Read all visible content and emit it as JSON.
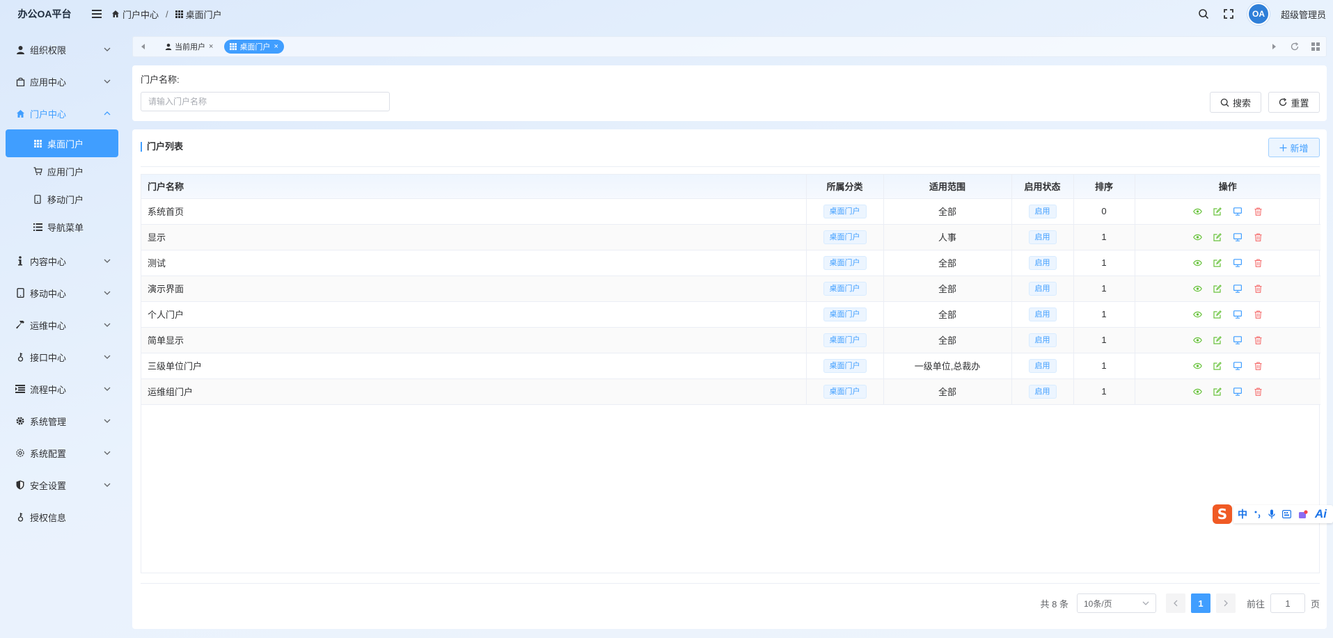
{
  "app": {
    "title": "办公OA平台"
  },
  "breadcrumb": [
    "门户中心",
    "桌面门户"
  ],
  "header": {
    "username": "超级管理员",
    "avatar_text": "OA"
  },
  "sidebar": {
    "items": [
      {
        "label": "组织权限",
        "icon": "user-icon"
      },
      {
        "label": "应用中心",
        "icon": "bag-icon"
      },
      {
        "label": "门户中心",
        "icon": "home-icon",
        "open": true,
        "children": [
          {
            "label": "桌面门户",
            "icon": "grid-icon",
            "active": true
          },
          {
            "label": "应用门户",
            "icon": "cart-icon"
          },
          {
            "label": "移动门户",
            "icon": "phone-icon"
          },
          {
            "label": "导航菜单",
            "icon": "list-icon"
          }
        ]
      },
      {
        "label": "内容中心",
        "icon": "info-icon"
      },
      {
        "label": "移动中心",
        "icon": "tablet-icon"
      },
      {
        "label": "运维中心",
        "icon": "hammer-icon"
      },
      {
        "label": "接口中心",
        "icon": "key-icon"
      },
      {
        "label": "流程中心",
        "icon": "process-icon"
      },
      {
        "label": "系统管理",
        "icon": "gear-icon"
      },
      {
        "label": "系统配置",
        "icon": "settings-icon"
      },
      {
        "label": "安全设置",
        "icon": "shield-icon"
      },
      {
        "label": "授权信息",
        "icon": "key-icon"
      }
    ]
  },
  "tabs": [
    {
      "label": "当前用户",
      "close": "×",
      "active": false
    },
    {
      "label": "桌面门户",
      "close": "×",
      "active": true
    }
  ],
  "search": {
    "label": "门户名称:",
    "placeholder": "请输入门户名称",
    "search_button": "搜索",
    "reset_button": "重置"
  },
  "list": {
    "title": "门户列表",
    "add_button": "新增",
    "columns": [
      "门户名称",
      "所属分类",
      "适用范围",
      "启用状态",
      "排序",
      "操作"
    ],
    "rows": [
      {
        "name": "系统首页",
        "category": "桌面门户",
        "scope": "全部",
        "status": "启用",
        "order": "0"
      },
      {
        "name": "显示",
        "category": "桌面门户",
        "scope": "人事",
        "status": "启用",
        "order": "1"
      },
      {
        "name": "测试",
        "category": "桌面门户",
        "scope": "全部",
        "status": "启用",
        "order": "1"
      },
      {
        "name": "演示界面",
        "category": "桌面门户",
        "scope": "全部",
        "status": "启用",
        "order": "1"
      },
      {
        "name": "个人门户",
        "category": "桌面门户",
        "scope": "全部",
        "status": "启用",
        "order": "1"
      },
      {
        "name": "简单显示",
        "category": "桌面门户",
        "scope": "全部",
        "status": "启用",
        "order": "1"
      },
      {
        "name": "三级单位门户",
        "category": "桌面门户",
        "scope": "一级单位,总裁办",
        "status": "启用",
        "order": "1"
      },
      {
        "name": "运维组门户",
        "category": "桌面门户",
        "scope": "全部",
        "status": "启用",
        "order": "1"
      }
    ]
  },
  "pagination": {
    "total": "共 8 条",
    "page_size": "10条/页",
    "current": "1",
    "goto_label": "前往",
    "goto_value": "1",
    "unit": "页"
  },
  "ime": {
    "logo": "S",
    "lang": "中",
    "ai": "Ai"
  },
  "colors": {
    "primary": "#409eff",
    "success": "#67c23a",
    "danger": "#f56c6c",
    "ime_orange": "#f05a24"
  }
}
